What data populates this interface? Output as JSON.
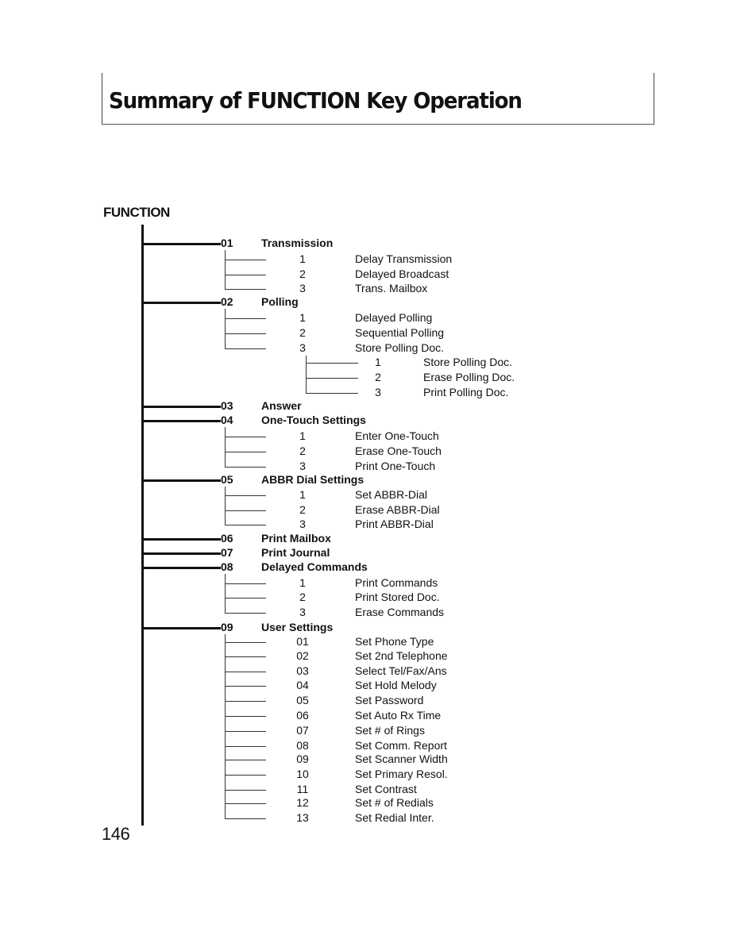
{
  "page": {
    "title": "Summary of FUNCTION Key Operation",
    "section_label": "FUNCTION",
    "page_number": "146"
  },
  "menu": [
    {
      "code": "01",
      "name": "Transmission",
      "items": [
        {
          "num": "1",
          "label": "Delay Transmission"
        },
        {
          "num": "2",
          "label": "Delayed Broadcast"
        },
        {
          "num": "3",
          "label": "Trans. Mailbox"
        }
      ]
    },
    {
      "code": "02",
      "name": "Polling",
      "items": [
        {
          "num": "1",
          "label": "Delayed Polling"
        },
        {
          "num": "2",
          "label": "Sequential Polling"
        },
        {
          "num": "3",
          "label": "Store Polling Doc.",
          "items": [
            {
              "num": "1",
              "label": "Store Polling Doc."
            },
            {
              "num": "2",
              "label": "Erase Polling Doc."
            },
            {
              "num": "3",
              "label": "Print Polling Doc."
            }
          ]
        }
      ]
    },
    {
      "code": "03",
      "name": "Answer",
      "items": []
    },
    {
      "code": "04",
      "name": "One-Touch Settings",
      "items": [
        {
          "num": "1",
          "label": "Enter One-Touch"
        },
        {
          "num": "2",
          "label": "Erase One-Touch"
        },
        {
          "num": "3",
          "label": "Print One-Touch"
        }
      ]
    },
    {
      "code": "05",
      "name": "ABBR Dial Settings",
      "items": [
        {
          "num": "1",
          "label": "Set ABBR-Dial"
        },
        {
          "num": "2",
          "label": "Erase ABBR-Dial"
        },
        {
          "num": "3",
          "label": "Print ABBR-Dial"
        }
      ]
    },
    {
      "code": "06",
      "name": "Print Mailbox",
      "items": []
    },
    {
      "code": "07",
      "name": "Print Journal",
      "items": []
    },
    {
      "code": "08",
      "name": "Delayed Commands",
      "items": [
        {
          "num": "1",
          "label": "Print Commands"
        },
        {
          "num": "2",
          "label": "Print Stored Doc."
        },
        {
          "num": "3",
          "label": "Erase Commands"
        }
      ]
    },
    {
      "code": "09",
      "name": "User Settings",
      "items": [
        {
          "num": "01",
          "label": "Set Phone Type"
        },
        {
          "num": "02",
          "label": "Set 2nd Telephone"
        },
        {
          "num": "03",
          "label": "Select Tel/Fax/Ans"
        },
        {
          "num": "04",
          "label": "Set Hold Melody"
        },
        {
          "num": "05",
          "label": "Set Password"
        },
        {
          "num": "06",
          "label": "Set Auto Rx Time"
        },
        {
          "num": "07",
          "label": "Set # of Rings"
        },
        {
          "num": "08",
          "label": "Set Comm. Report"
        },
        {
          "num": "09",
          "label": "Set Scanner Width"
        },
        {
          "num": "10",
          "label": "Set Primary Resol."
        },
        {
          "num": "11",
          "label": "Set Contrast"
        },
        {
          "num": "12",
          "label": "Set # of Redials"
        },
        {
          "num": "13",
          "label": "Set Redial Inter."
        }
      ]
    }
  ]
}
